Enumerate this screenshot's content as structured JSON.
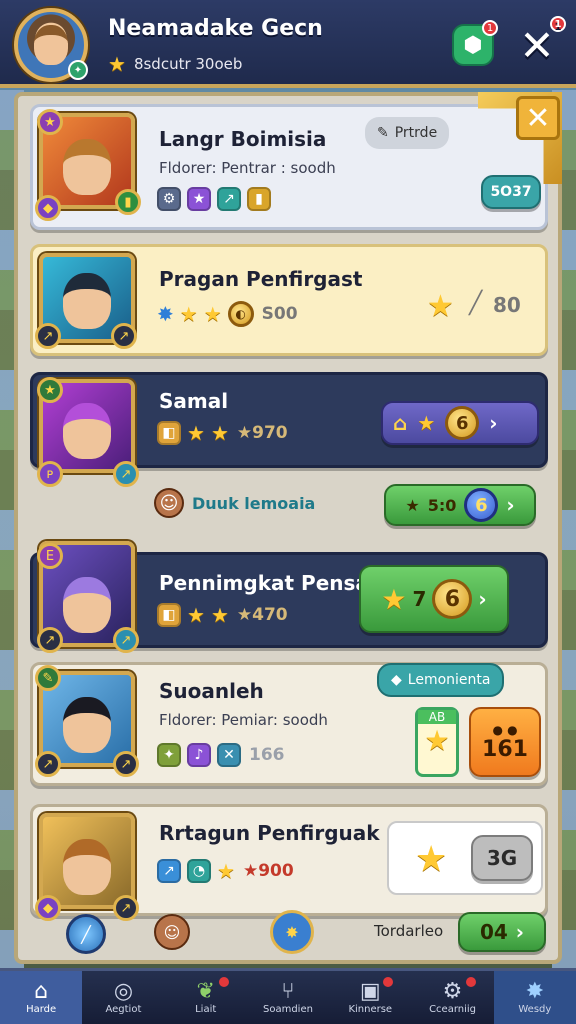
{
  "header": {
    "player_name": "Neamadake Gecn",
    "player_sub": "8sdcutr 30oeb",
    "green_badge_count": "1",
    "close_badge_count": "1"
  },
  "cards": [
    {
      "title": "Langr Boimisia",
      "subtitle": "Fldorer: Pentrar : soodh",
      "tag": "Prtrde",
      "button": "5O37"
    },
    {
      "title": "Pragan Penfirgast",
      "value": "S00",
      "right_value": "80"
    },
    {
      "title": "Samal",
      "value": "970",
      "coin": "6"
    },
    {
      "row_label": "Duuk lemoaia",
      "value": "5:0",
      "coin": "6"
    },
    {
      "title": "Pennimgkat Pensa",
      "value": "470",
      "button_num": "7",
      "coin": "6"
    },
    {
      "title": "Suoanleh",
      "subtitle": "Fldorer: Pemiar: soodh",
      "value": "166",
      "tag": "Lemonienta",
      "badge_top": "AB",
      "orange_value": "161"
    },
    {
      "title": "Rrtagun Penfirguak",
      "value": "900",
      "grey_value": "3G"
    }
  ],
  "bottom_row": {
    "label": "Tordarleo",
    "button": "04"
  },
  "nav": [
    {
      "label": "Harde",
      "icon": "home-icon"
    },
    {
      "label": "Aegtiot",
      "icon": "target-icon"
    },
    {
      "label": "Liait",
      "icon": "leaf-icon"
    },
    {
      "label": "Soamdien",
      "icon": "fork-icon"
    },
    {
      "label": "Kinnerse",
      "icon": "inbox-icon"
    },
    {
      "label": "Ccearniig",
      "icon": "gear-icon"
    },
    {
      "label": "Wesdy",
      "icon": "star-icon"
    }
  ],
  "colors": {
    "header_bg": "#25304f",
    "accent_gold": "#e0b25c",
    "green": "#3a9a3c",
    "orange": "#f07a1e"
  }
}
